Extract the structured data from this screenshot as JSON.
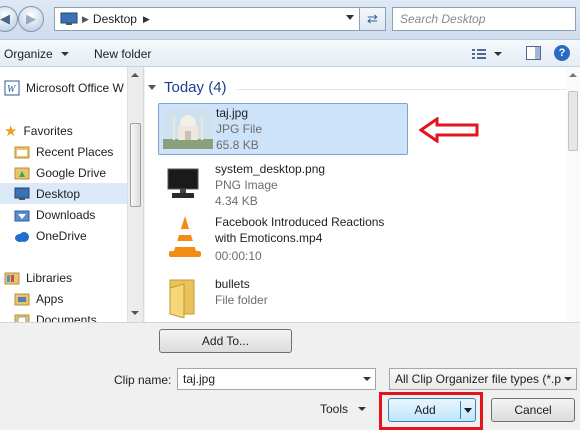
{
  "address": {
    "segment": "Desktop"
  },
  "search": {
    "placeholder": "Search Desktop"
  },
  "toolbar": {
    "organize": "Organize",
    "new_folder": "New folder"
  },
  "nav": {
    "items": [
      {
        "label": "Microsoft Office W",
        "icon": "word-icon"
      },
      {
        "label": "Favorites",
        "icon": "star-icon"
      },
      {
        "label": "Recent Places",
        "icon": "recent-places-icon"
      },
      {
        "label": "Google Drive",
        "icon": "google-drive-icon"
      },
      {
        "label": "Desktop",
        "icon": "desktop-icon",
        "selected": true
      },
      {
        "label": "Downloads",
        "icon": "downloads-icon"
      },
      {
        "label": "OneDrive",
        "icon": "cloud-icon"
      },
      {
        "label": "Libraries",
        "icon": "libraries-icon"
      },
      {
        "label": "Apps",
        "icon": "apps-icon"
      },
      {
        "label": "Documents",
        "icon": "documents-icon"
      }
    ]
  },
  "content": {
    "group_header": "Today (4)",
    "files": [
      {
        "name": "taj.jpg",
        "line2": "JPG File",
        "line3": "65.8 KB",
        "icon": "image-thumbnail"
      },
      {
        "name": "system_desktop.png",
        "line2": "PNG Image",
        "line3": "4.34 KB",
        "icon": "computer-icon"
      },
      {
        "name": "Facebook Introduced Reactions",
        "name2": "with Emoticons.mp4",
        "line3": "00:00:10",
        "icon": "vlc-cone-icon"
      },
      {
        "name": "bullets",
        "line2": "File folder",
        "icon": "folder-icon"
      }
    ]
  },
  "bottom": {
    "add_to": "Add To...",
    "clip_name_label": "Clip name:",
    "clip_name_value": "taj.jpg",
    "filetype": "All Clip Organizer file types (*.p",
    "tools": "Tools",
    "add": "Add",
    "cancel": "Cancel"
  },
  "colors": {
    "annotation_red": "#e3141b",
    "selection": "#cde3f9"
  }
}
